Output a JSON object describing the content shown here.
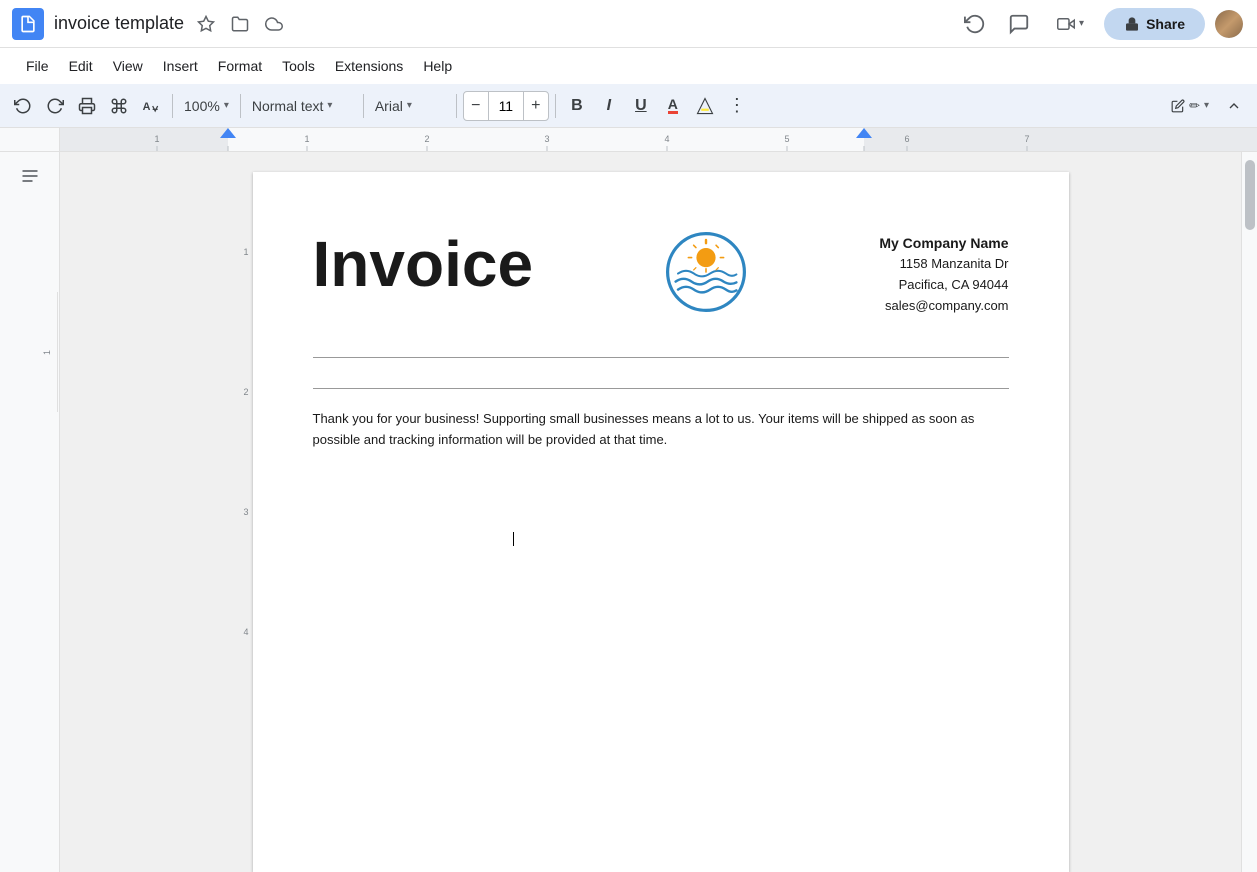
{
  "app": {
    "icon_color": "#4285f4",
    "doc_title": "invoice template",
    "star_icon": "☆",
    "folder_icon": "📁",
    "cloud_icon": "☁"
  },
  "header": {
    "history_icon": "↺",
    "comment_icon": "💬",
    "video_label": "▶",
    "video_caret": "▾",
    "share_icon": "🔒",
    "share_label": "Share"
  },
  "menu": {
    "items": [
      "File",
      "Edit",
      "View",
      "Insert",
      "Format",
      "Tools",
      "Extensions",
      "Help"
    ]
  },
  "toolbar": {
    "undo_label": "↩",
    "redo_label": "↪",
    "print_label": "🖨",
    "paintformat_label": "🖌",
    "spellcheck_label": "✓A",
    "zoom_value": "100%",
    "zoom_caret": "▾",
    "style_value": "Normal text",
    "style_caret": "▾",
    "font_value": "Arial",
    "font_caret": "▾",
    "font_size": "11",
    "bold_label": "B",
    "italic_label": "I",
    "underline_label": "U",
    "font_color_label": "A",
    "highlight_label": "✏",
    "more_label": "⋮",
    "edit_icon": "✏",
    "expand_icon": "⌃"
  },
  "ruler": {
    "numbers": [
      "-1",
      "1",
      "2",
      "3",
      "4",
      "5",
      "6",
      "7"
    ],
    "left_indent": 228,
    "right_indent": 1005
  },
  "document": {
    "invoice_title": "Invoice",
    "company_name": "My Company Name",
    "company_address1": "1158 Manzanita Dr",
    "company_address2": "Pacifica, CA 94044",
    "company_email": "sales@company.com",
    "thank_you_text": "Thank you for your business! Supporting small businesses means a lot to us. Your items will be shipped as soon as possible and tracking information will be provided at that time."
  },
  "outline": {
    "icon": "≡"
  }
}
